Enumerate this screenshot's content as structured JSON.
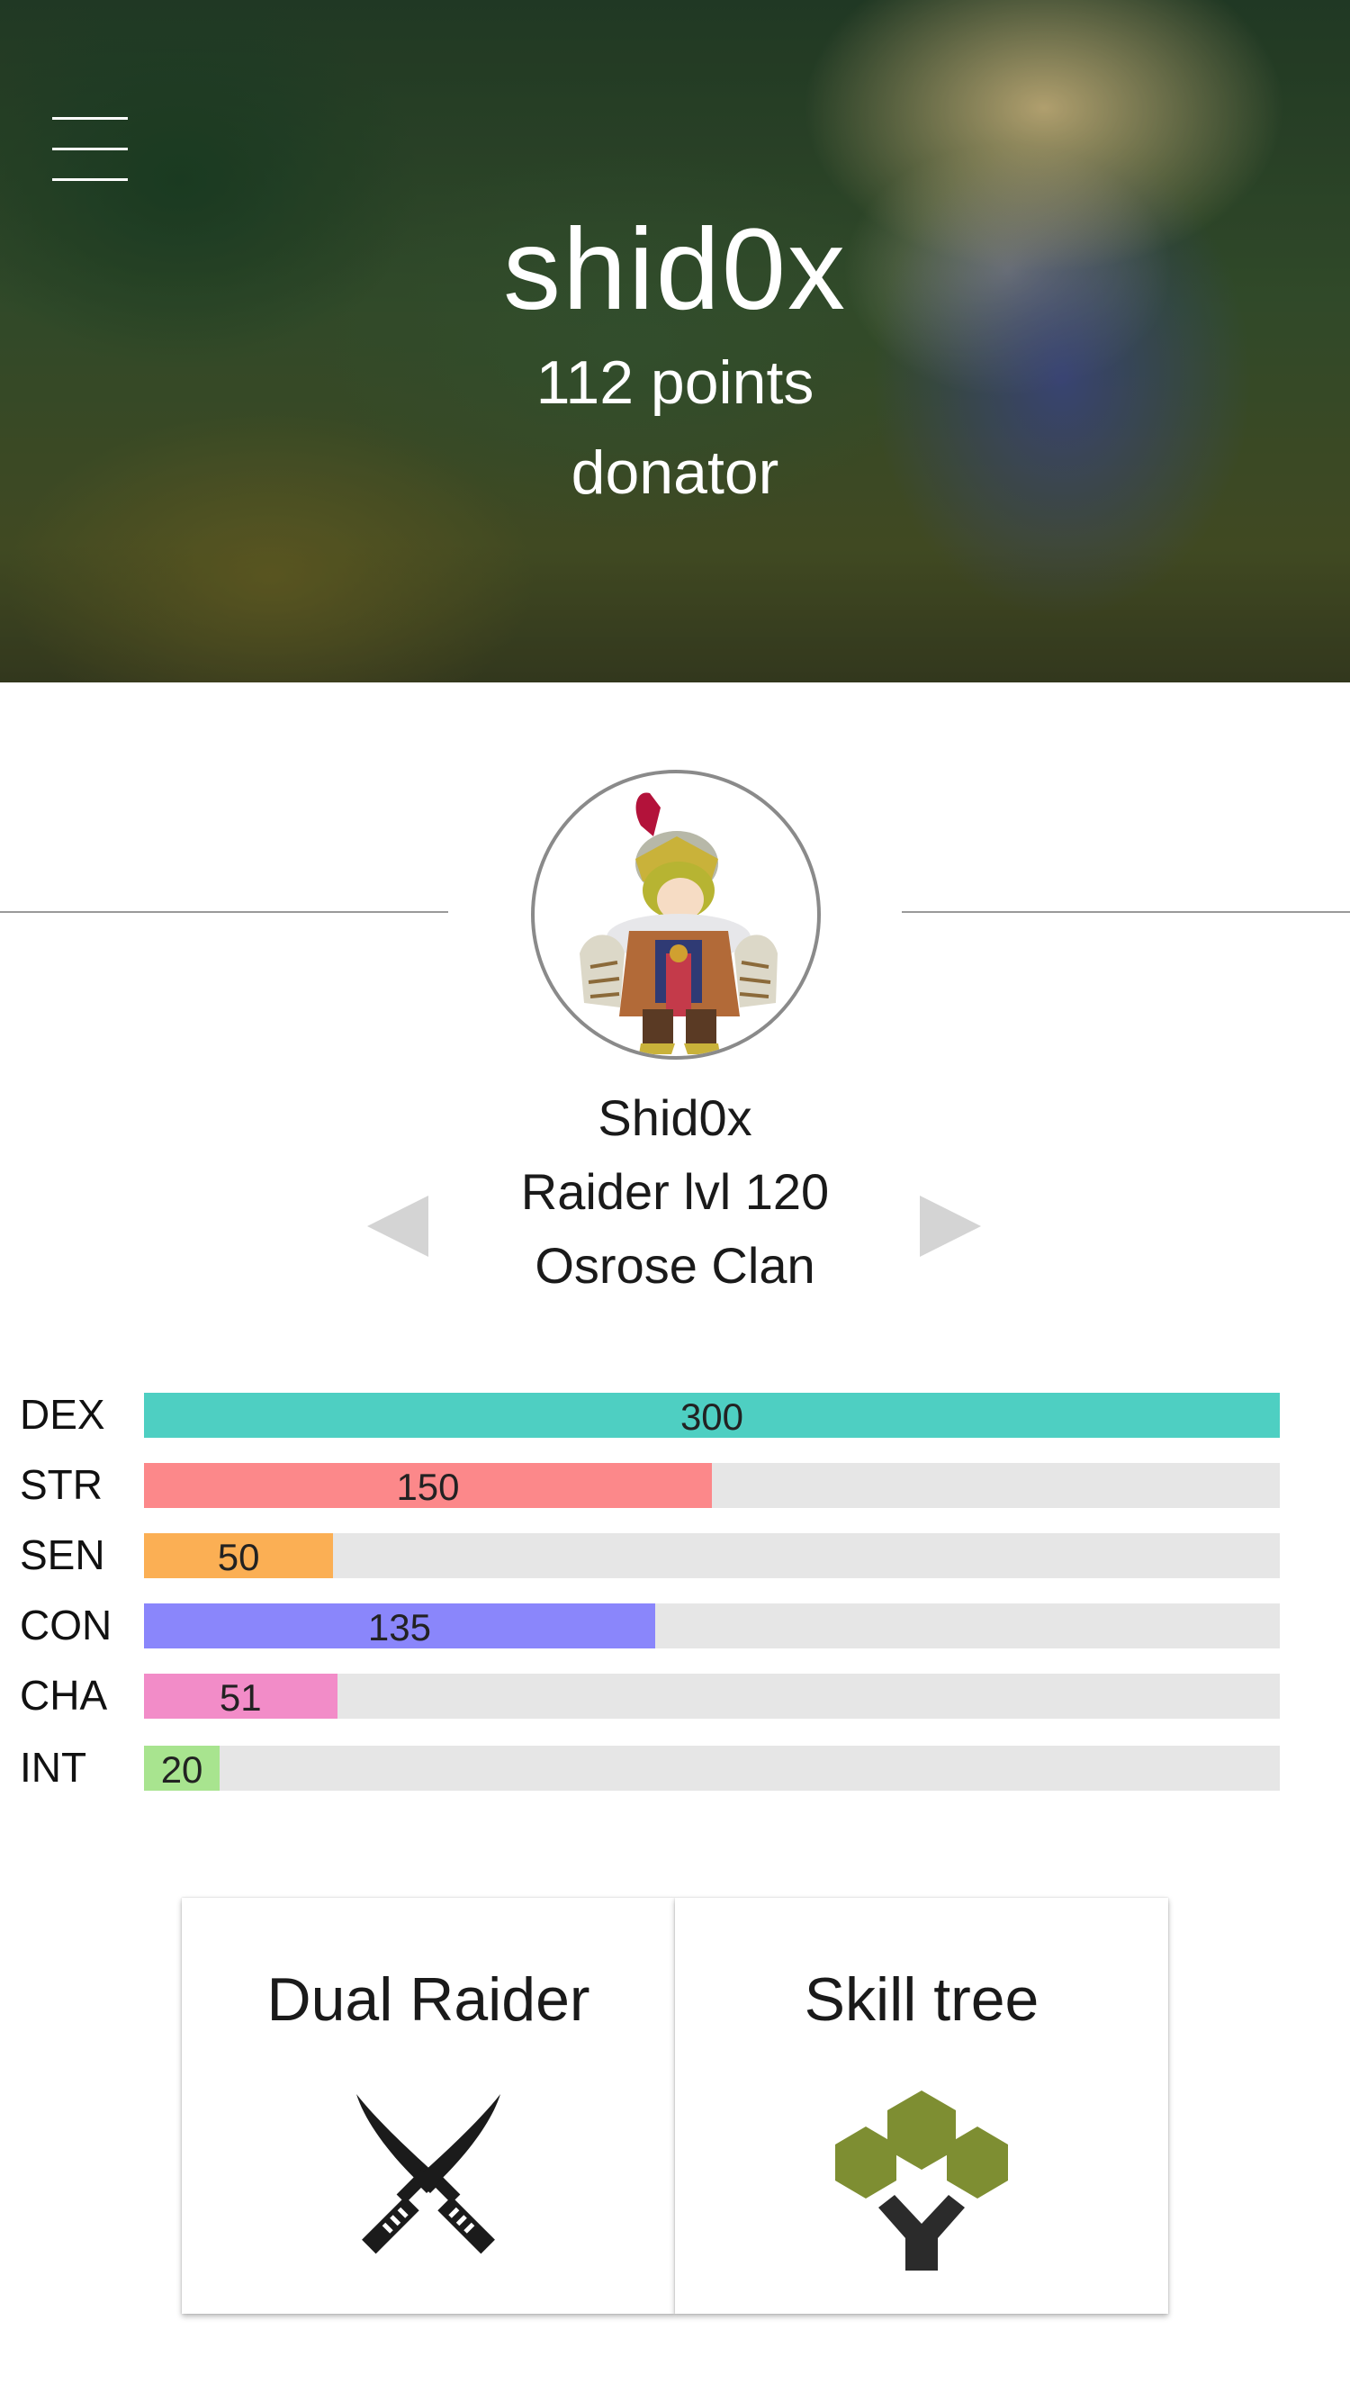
{
  "header": {
    "username": "shid0x",
    "points": "112 points",
    "rank": "donator"
  },
  "character": {
    "name": "Shid0x",
    "class_level": "Raider lvl 120",
    "clan": "Osrose Clan"
  },
  "stats": [
    {
      "label": "DEX",
      "value": 300,
      "display": "300",
      "max": 300,
      "color": "#4ecfc2"
    },
    {
      "label": "STR",
      "value": 150,
      "display": "150",
      "max": 300,
      "color": "#fc888a"
    },
    {
      "label": "SEN",
      "value": 50,
      "display": "50",
      "max": 300,
      "color": "#fbaf54"
    },
    {
      "label": "CON",
      "value": 135,
      "display": "135",
      "max": 300,
      "color": "#8a86fb"
    },
    {
      "label": "CHA",
      "value": 51,
      "display": "51",
      "max": 300,
      "color": "#f28cc8"
    },
    {
      "label": "INT",
      "value": 20,
      "display": "20",
      "max": 300,
      "color": "#a8e48f"
    }
  ],
  "cards": [
    {
      "title": "Dual Raider",
      "icon": "crossed-swords-icon"
    },
    {
      "title": "Skill tree",
      "icon": "skill-tree-icon"
    }
  ],
  "colors": {
    "track": "#e6e6e6",
    "tree_leaves": "#7e8e32",
    "tree_trunk": "#2b2b2b"
  }
}
